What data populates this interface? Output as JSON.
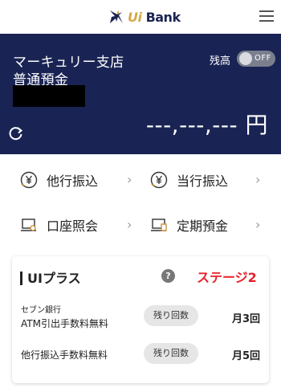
{
  "header": {
    "logo_main": "Ui",
    "logo_sub": "Bank",
    "logo_icon": "x-cross-logo-icon",
    "menu_icon": "hamburger-menu-icon"
  },
  "account": {
    "branch": "マーキュリー支店",
    "type": "普通預金",
    "balance_label": "残高",
    "toggle_text": "OFF",
    "balance": "---,---,--- 円",
    "refresh_icon": "refresh-icon",
    "colors": {
      "background": "#1a2454",
      "text": "#ffffff"
    }
  },
  "menu": [
    {
      "label": "他行振込",
      "icon": "yen-transfer-icon"
    },
    {
      "label": "当行振込",
      "icon": "yen-transfer-icon"
    },
    {
      "label": "口座照会",
      "icon": "laptop-search-icon"
    },
    {
      "label": "定期預金",
      "icon": "laptop-deposit-icon"
    }
  ],
  "ui_plus": {
    "title": "UIプラス",
    "help": "?",
    "stage": "ステージ2",
    "stage_color": "#e8212b",
    "rows": [
      {
        "label_line1": "セブン銀行",
        "label_line2": "ATM引出手数料無料",
        "pill": "残り回数",
        "count": "月3回"
      },
      {
        "label": "他行振込手数料無料",
        "pill": "残り回数",
        "count": "月5回"
      }
    ]
  }
}
